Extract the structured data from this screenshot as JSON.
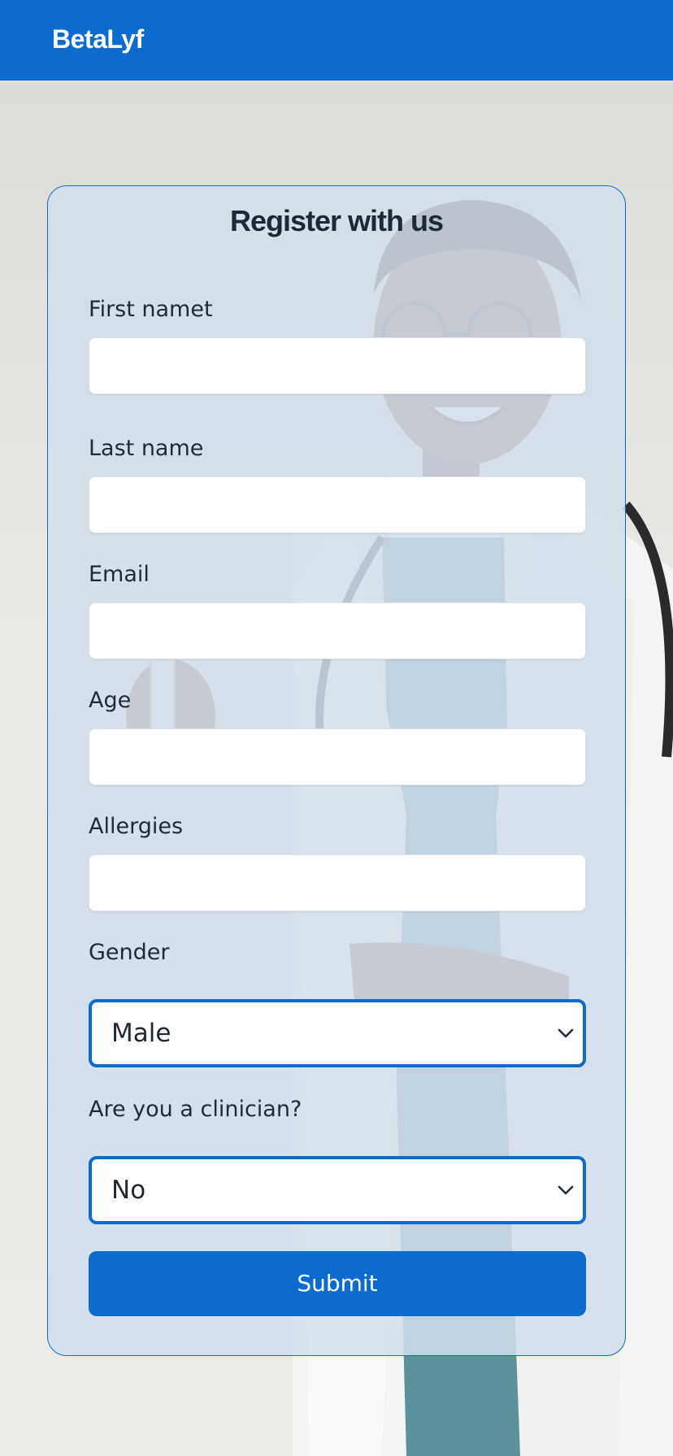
{
  "navbar": {
    "brand": "BetaLyf"
  },
  "form": {
    "title": "Register with us",
    "first_name_label": "First namet",
    "first_name_value": "",
    "last_name_label": "Last name",
    "last_name_value": "",
    "email_label": "Email",
    "email_value": "",
    "age_label": "Age",
    "age_value": "",
    "allergies_label": "Allergies",
    "allergies_value": "",
    "gender_label": "Gender",
    "gender_value": "Male",
    "clinician_label": "Are you a clinician?",
    "clinician_value": "No",
    "submit_label": "Submit"
  },
  "colors": {
    "primary": "#0b6bce",
    "card_border": "#0b6bce",
    "card_background": "#d2deec",
    "text": "#212b36",
    "page_background": "#e6e6e2"
  },
  "icons": {
    "select_arrow": "chevron-down-icon"
  },
  "background_image": "photo of a smiling doctor in a white coat with a stethoscope"
}
